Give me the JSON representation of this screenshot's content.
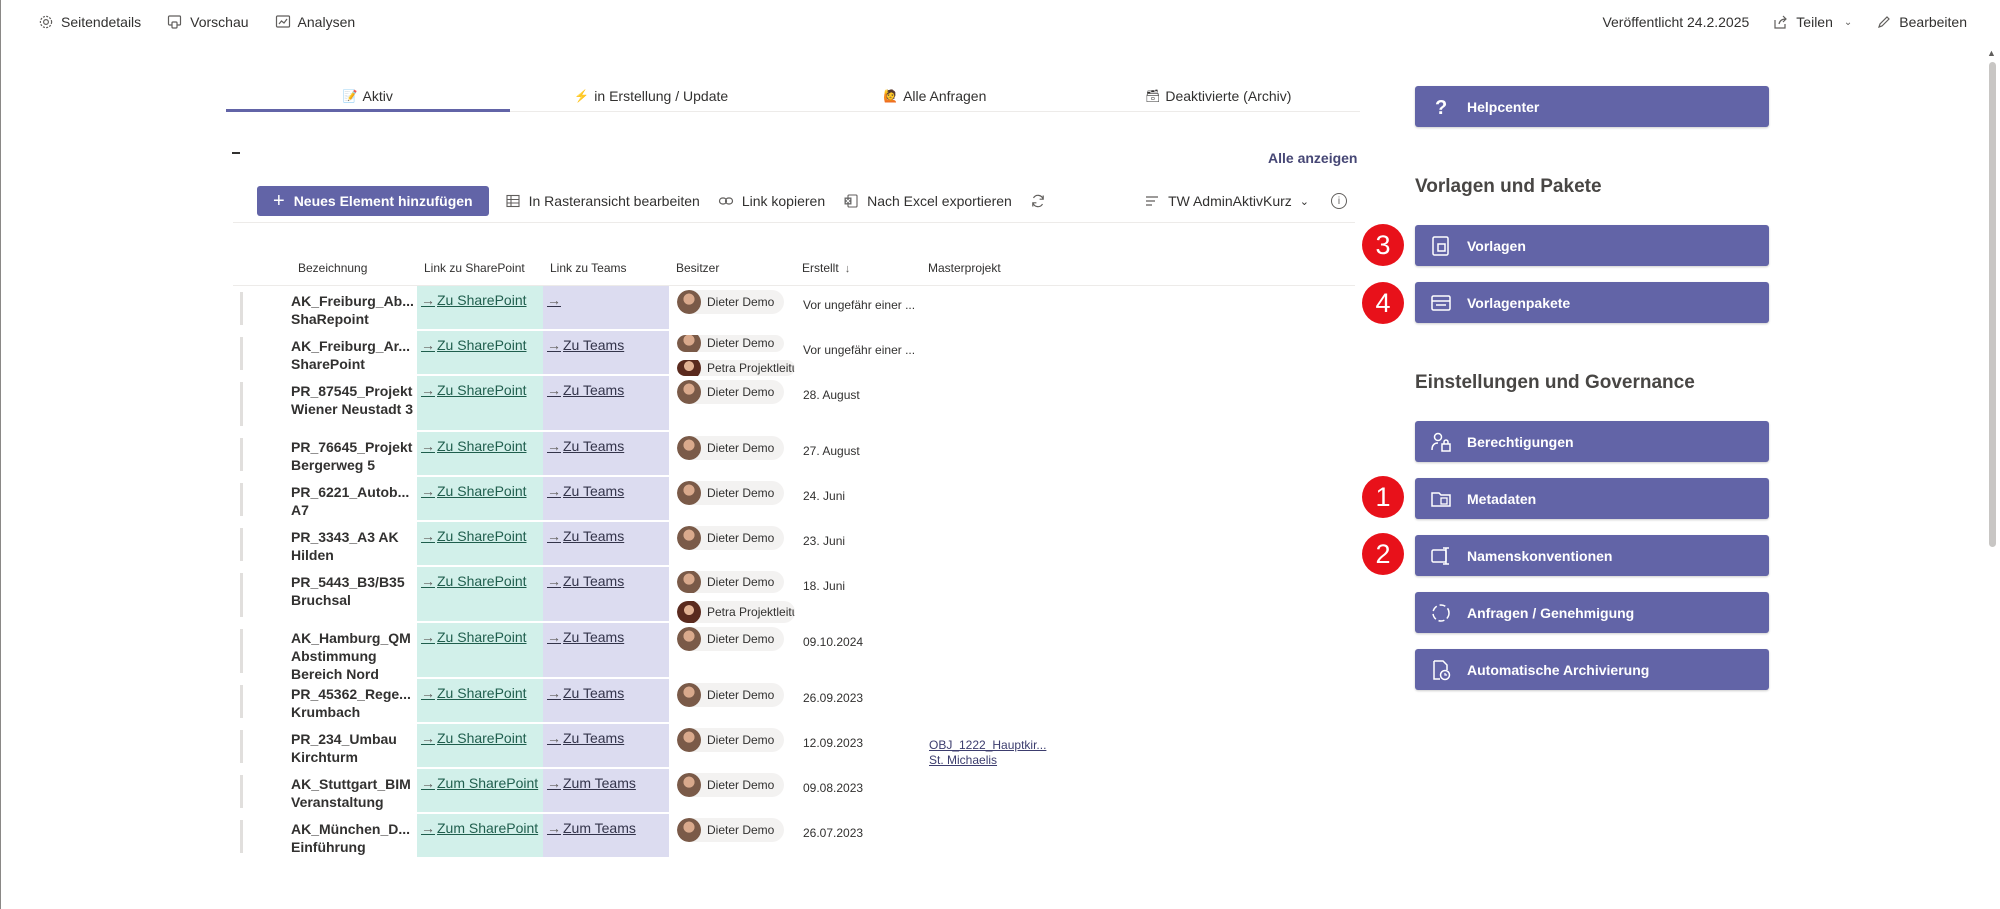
{
  "topbar": {
    "left": [
      {
        "label": "Seitendetails",
        "icon": "gear-icon"
      },
      {
        "label": "Vorschau",
        "icon": "preview-icon"
      },
      {
        "label": "Analysen",
        "icon": "analytics-icon"
      }
    ],
    "published": "Veröffentlicht 24.2.2025",
    "share": "Teilen",
    "edit": "Bearbeiten"
  },
  "tabs": [
    {
      "label": "Aktiv",
      "emoji": "📝",
      "active": true
    },
    {
      "label": "in Erstellung / Update",
      "emoji": "⚡",
      "active": false
    },
    {
      "label": "Alle Anfragen",
      "emoji": "🙋",
      "active": false
    },
    {
      "label": "Deaktivierte (Archiv)",
      "emoji": "🗃",
      "active": false
    }
  ],
  "list": {
    "show_all": "Alle anzeigen",
    "toolbar": {
      "new_item": "Neues Element hinzufügen",
      "grid_edit": "In Rasteransicht bearbeiten",
      "copy_link": "Link kopieren",
      "export_excel": "Nach Excel exportieren",
      "view": "TW AdminAktivKurz"
    },
    "columns": [
      "Bezeichnung",
      "Link zu SharePoint",
      "Link zu Teams",
      "Besitzer",
      "Erstellt",
      "Masterprojekt"
    ],
    "rows": [
      {
        "title": "AK_Freiburg_Ab... ShaRepoint",
        "sp": "Zu SharePoint",
        "teams": "",
        "owners": [
          "Dieter Demo"
        ],
        "created": "Vor ungefähr einer ...",
        "master": ""
      },
      {
        "title": "AK_Freiburg_Ar... SharePoint Einführung",
        "sp": "Zu SharePoint",
        "teams": "Zu Teams",
        "owners": [
          "Dieter Demo",
          "Petra Projektleitung"
        ],
        "created": "Vor ungefähr einer ...",
        "master": ""
      },
      {
        "title": "PR_87545_Projekt Wiener Neustadt 3",
        "sp": "Zu SharePoint",
        "teams": "Zu Teams",
        "owners": [
          "Dieter Demo"
        ],
        "created": "28. August",
        "master": ""
      },
      {
        "title": "PR_76645_Projekt Bergerweg 5",
        "sp": "Zu SharePoint",
        "teams": "Zu Teams",
        "owners": [
          "Dieter Demo"
        ],
        "created": "27. August",
        "master": ""
      },
      {
        "title": "PR_6221_Autob... A7",
        "sp": "Zu SharePoint",
        "teams": "Zu Teams",
        "owners": [
          "Dieter Demo"
        ],
        "created": "24. Juni",
        "master": ""
      },
      {
        "title": "PR_3343_A3 AK Hilden",
        "sp": "Zu SharePoint",
        "teams": "Zu Teams",
        "owners": [
          "Dieter Demo"
        ],
        "created": "23. Juni",
        "master": ""
      },
      {
        "title": "PR_5443_B3/B35 Bruchsal",
        "sp": "Zu SharePoint",
        "teams": "Zu Teams",
        "owners": [
          "Dieter Demo",
          "Petra Projektleitung"
        ],
        "created": "18. Juni",
        "master": ""
      },
      {
        "title": "AK_Hamburg_QM Abstimmung Bereich Nord",
        "sp": "Zu SharePoint",
        "teams": "Zu Teams",
        "owners": [
          "Dieter Demo"
        ],
        "created": "09.10.2024",
        "master": ""
      },
      {
        "title": "PR_45362_Rege... Krumbach",
        "sp": "Zu SharePoint",
        "teams": "Zu Teams",
        "owners": [
          "Dieter Demo"
        ],
        "created": "26.09.2023",
        "master": ""
      },
      {
        "title": "PR_234_Umbau Kirchturm",
        "sp": "Zu SharePoint",
        "teams": "Zu Teams",
        "owners": [
          "Dieter Demo"
        ],
        "created": "12.09.2023",
        "master": "OBJ_1222_Hauptkir... St. Michaelis"
      },
      {
        "title": "AK_Stuttgart_BIM Veranstaltung",
        "sp": "Zum SharePoint",
        "teams": "Zum Teams",
        "owners": [
          "Dieter Demo"
        ],
        "created": "09.08.2023",
        "master": ""
      },
      {
        "title": "AK_München_D... Einführung",
        "sp": "Zum SharePoint",
        "teams": "Zum Teams",
        "owners": [
          "Dieter Demo"
        ],
        "created": "26.07.2023",
        "master": ""
      }
    ]
  },
  "panel": {
    "helpcenter": "Helpcenter",
    "section1": "Vorlagen und Pakete",
    "vorlagen": "Vorlagen",
    "vorlagenpakete": "Vorlagenpakete",
    "section2": "Einstellungen und Governance",
    "berechtigungen": "Berechtigungen",
    "metadaten": "Metadaten",
    "namenskonventionen": "Namenskonventionen",
    "anfragen": "Anfragen / Genehmigung",
    "archivierung": "Automatische Archivierung",
    "badges": {
      "metadaten": "1",
      "namenskonventionen": "2",
      "vorlagen": "3",
      "vorlagenpakete": "4"
    },
    "accent": "#6264a7",
    "badge_color": "#e8111a"
  }
}
